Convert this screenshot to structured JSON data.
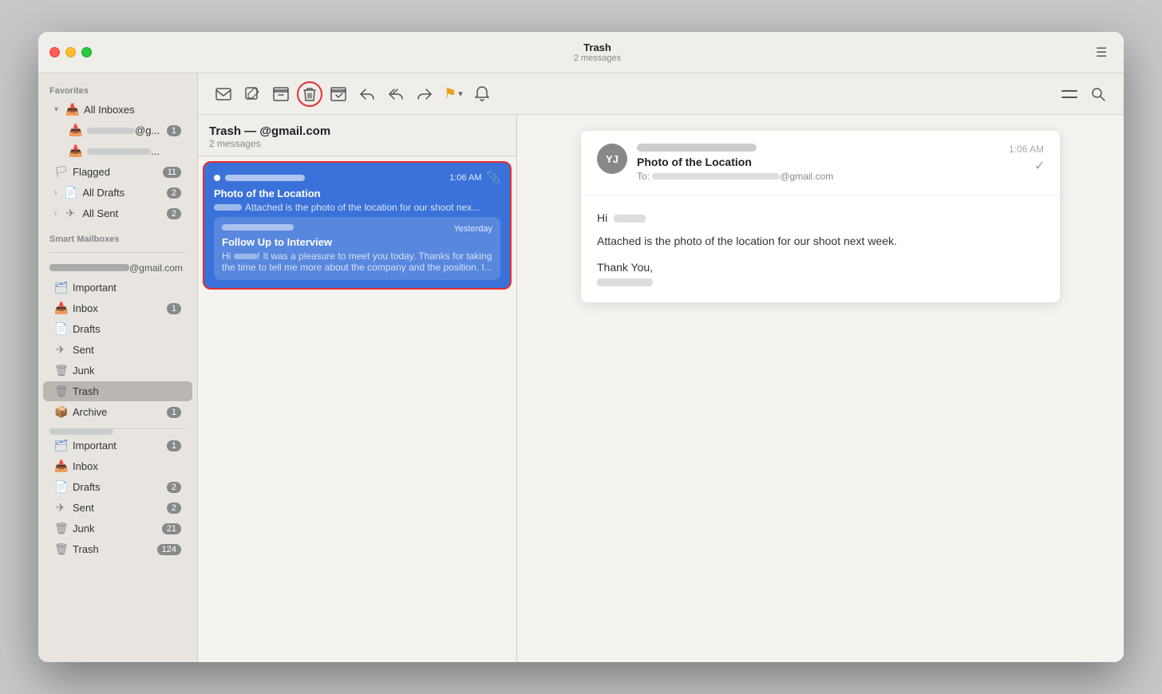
{
  "window": {
    "title": "Trash",
    "email": "@gmail.com",
    "message_count": "2 messages"
  },
  "toolbar": {
    "icons": [
      "mail",
      "compose",
      "archive",
      "trash",
      "move",
      "reply",
      "reply-all",
      "forward",
      "flag",
      "notify",
      "more",
      "search"
    ],
    "flag_label": "",
    "flag_chevron": "▾"
  },
  "sidebar": {
    "favorites_label": "Favorites",
    "all_inboxes_label": "All Inboxes",
    "flagged_label": "Flagged",
    "flagged_count": "11",
    "all_drafts_label": "All Drafts",
    "all_drafts_count": "2",
    "all_sent_label": "All Sent",
    "all_sent_count": "2",
    "smart_mailboxes_label": "Smart Mailboxes",
    "account1_label": "@gmail.com",
    "account1_items": [
      {
        "label": "Important",
        "icon": "folder",
        "count": ""
      },
      {
        "label": "Inbox",
        "icon": "inbox",
        "count": "1"
      },
      {
        "label": "Drafts",
        "icon": "draft",
        "count": ""
      },
      {
        "label": "Sent",
        "icon": "sent",
        "count": ""
      },
      {
        "label": "Junk",
        "icon": "junk",
        "count": ""
      },
      {
        "label": "Trash",
        "icon": "trash",
        "count": "",
        "active": true
      },
      {
        "label": "Archive",
        "icon": "archive",
        "count": "1"
      }
    ],
    "account2_items": [
      {
        "label": "Important",
        "icon": "folder",
        "count": "1"
      },
      {
        "label": "Inbox",
        "icon": "inbox",
        "count": ""
      },
      {
        "label": "Drafts",
        "icon": "draft",
        "count": "2"
      },
      {
        "label": "Sent",
        "icon": "sent",
        "count": "2"
      },
      {
        "label": "Junk",
        "icon": "junk",
        "count": "21"
      },
      {
        "label": "Trash",
        "icon": "trash",
        "count": "124"
      }
    ]
  },
  "email_list": {
    "title": "Trash — @gmail.com",
    "count": "2 messages",
    "emails": [
      {
        "subject": "Photo of the Location",
        "preview": "Hi [name]. Attached is the photo of the location for our shoot nex...",
        "time": "1:06 AM",
        "has_attachment": true,
        "selected": true
      },
      {
        "subject": "Follow Up to Interview",
        "preview": "Hi [name]! It was a pleasure to meet you today. Thanks for taking the time to tell me more about the company and the position. I...",
        "time": "Yesterday",
        "selected": false
      }
    ]
  },
  "email_view": {
    "avatar_initials": "YJ",
    "subject": "Photo of the Location",
    "to_label": "To:",
    "to_email": "@gmail.com",
    "time": "1:06 AM",
    "greeting": "Hi",
    "body_line1": "Attached is the photo of the location for our shoot next week.",
    "body_thanks": "Thank You,"
  }
}
